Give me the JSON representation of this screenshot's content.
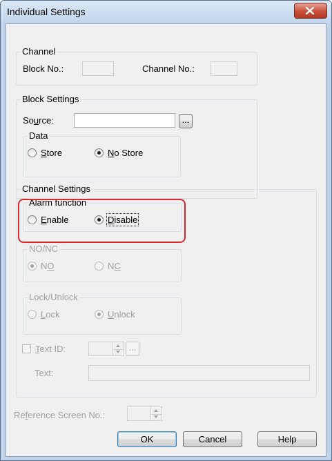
{
  "window": {
    "title": "Individual Settings"
  },
  "channel": {
    "legend": "Channel",
    "block_no_label": "Block No.:",
    "block_no_value": "",
    "channel_no_label": "Channel No.:",
    "channel_no_value": ""
  },
  "block_settings": {
    "legend": "Block Settings",
    "source_label_pre": "So",
    "source_label_ul": "u",
    "source_label_post": "rce:",
    "source_value": "",
    "browse_label": "...",
    "data": {
      "legend": "Data",
      "store_ul": "S",
      "store_rest": "tore",
      "nostore_ul": "N",
      "nostore_rest": "o Store",
      "selected": "No Store"
    }
  },
  "channel_settings": {
    "legend": "Channel Settings",
    "alarm": {
      "legend": "Alarm function",
      "enable_ul": "E",
      "enable_rest": "nable",
      "disable_ul": "D",
      "disable_rest": "isable",
      "selected": "Disable"
    },
    "nonc": {
      "legend": "NO/NC",
      "no_pre": "N",
      "no_ul": "O",
      "nc_pre": "N",
      "nc_ul": "C",
      "selected": "NO"
    },
    "lock": {
      "legend": "Lock/Unlock",
      "lock_ul": "L",
      "lock_rest": "ock",
      "unlock_ul": "U",
      "unlock_rest": "nlock",
      "selected": "Unlock"
    },
    "text_id_ul": "T",
    "text_id_rest": "ext ID:",
    "text_id_value": "",
    "text_id_browse": "...",
    "text_label": "Text:",
    "text_value": ""
  },
  "reference": {
    "label_pre": "Re",
    "label_ul": "f",
    "label_post": "erence Screen No.:",
    "value": ""
  },
  "buttons": {
    "ok": "OK",
    "cancel": "Cancel",
    "help": "Help"
  },
  "colors": {
    "highlight": "#d7282e",
    "close_button": "#c8503c"
  }
}
